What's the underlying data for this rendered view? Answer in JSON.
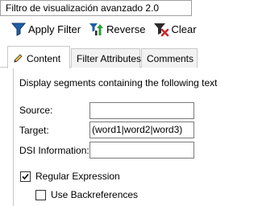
{
  "window": {
    "title": "Filtro de visualización avanzado 2.0"
  },
  "toolbar": {
    "apply_label": "Apply Filter",
    "reverse_label": "Reverse",
    "clear_label": "Clear"
  },
  "tabs": [
    {
      "label": "Content",
      "active": true
    },
    {
      "label": "Filter Attributes",
      "active": false
    },
    {
      "label": "Comments",
      "active": false
    }
  ],
  "content": {
    "description": "Display segments containing the following text",
    "source": {
      "label": "Source:",
      "value": ""
    },
    "target": {
      "label": "Target:",
      "value": "(word1|word2|word3)"
    },
    "dsi": {
      "label": "DSI Information:",
      "value": ""
    },
    "regex": {
      "label": "Regular Expression",
      "checked": true
    },
    "backrefs": {
      "label": "Use Backreferences",
      "checked": false
    }
  },
  "colors": {
    "funnel": "#1f5fa8",
    "arrow_green": "#2e9e3a",
    "arrow_dark": "#2b2b2b",
    "clear_red": "#d0242b"
  }
}
